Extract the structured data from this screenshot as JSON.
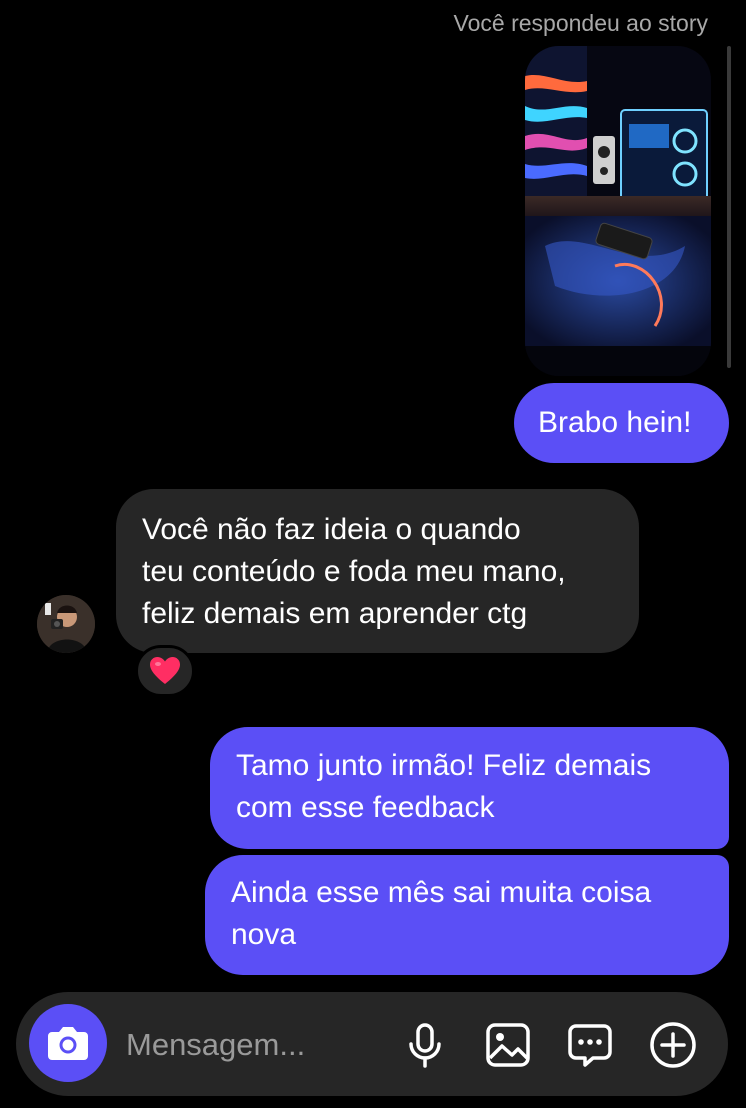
{
  "story": {
    "caption": "Você respondeu ao story"
  },
  "messages": [
    {
      "direction": "outgoing",
      "text": "Brabo hein!"
    },
    {
      "direction": "incoming",
      "text": "Você não faz ideia o quando\nteu conteúdo e foda meu mano,\nfeliz demais em aprender ctg",
      "reaction": "heart"
    },
    {
      "direction": "outgoing",
      "text": "Tamo junto irmão! Feliz demais\ncom esse feedback"
    },
    {
      "direction": "outgoing",
      "text": "Ainda esse mês sai muita coisa\nnova"
    }
  ],
  "composer": {
    "placeholder": "Mensagem...",
    "icons": [
      "camera-icon",
      "microphone-icon",
      "image-gallery-icon",
      "sticker-chat-icon",
      "plus-circle-icon"
    ]
  },
  "colors": {
    "background": "#000000",
    "outgoing_bubble": "#5b4ff6",
    "incoming_bubble": "#262626",
    "composer_bar": "#262626",
    "caption_text": "#a8a8a8",
    "reaction_heart": "#ff2e63"
  }
}
